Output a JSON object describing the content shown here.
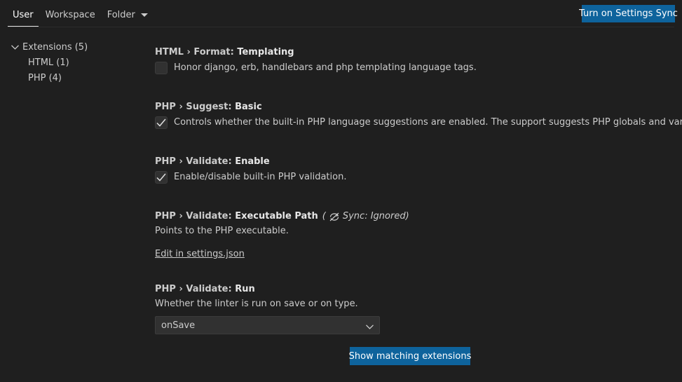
{
  "header": {
    "tabs": [
      {
        "label": "User",
        "active": true
      },
      {
        "label": "Workspace",
        "active": false
      },
      {
        "label": "Folder",
        "active": false
      }
    ],
    "sync_button": "Turn on Settings Sync"
  },
  "toc": {
    "root": "Extensions (5)",
    "children": [
      "HTML (1)",
      "PHP (4)"
    ]
  },
  "settings": [
    {
      "category": "HTML › Format: ",
      "name": "Templating",
      "type": "boolean",
      "checked": false,
      "description": "Honor django, erb, handlebars and php templating language tags."
    },
    {
      "category": "PHP › Suggest: ",
      "name": "Basic",
      "type": "boolean",
      "checked": true,
      "description": "Controls whether the built-in PHP language suggestions are enabled. The support suggests PHP globals and variables."
    },
    {
      "category": "PHP › Validate: ",
      "name": "Enable",
      "type": "boolean",
      "checked": true,
      "description": "Enable/disable built-in PHP validation."
    },
    {
      "category": "PHP › Validate: ",
      "name": "Executable Path",
      "type": "link",
      "sync_open": "(",
      "sync_label": "Sync: Ignored)",
      "description": "Points to the PHP executable.",
      "link": "Edit in settings.json"
    },
    {
      "category": "PHP › Validate: ",
      "name": "Run",
      "type": "select",
      "description": "Whether the linter is run on save or on type.",
      "value": "onSave"
    }
  ],
  "footer": {
    "show_extensions_button": "Show matching extensions"
  },
  "colors": {
    "accent_button": "#0e639c",
    "background": "#1f1f1f",
    "checkbox_bg": "#313131"
  }
}
